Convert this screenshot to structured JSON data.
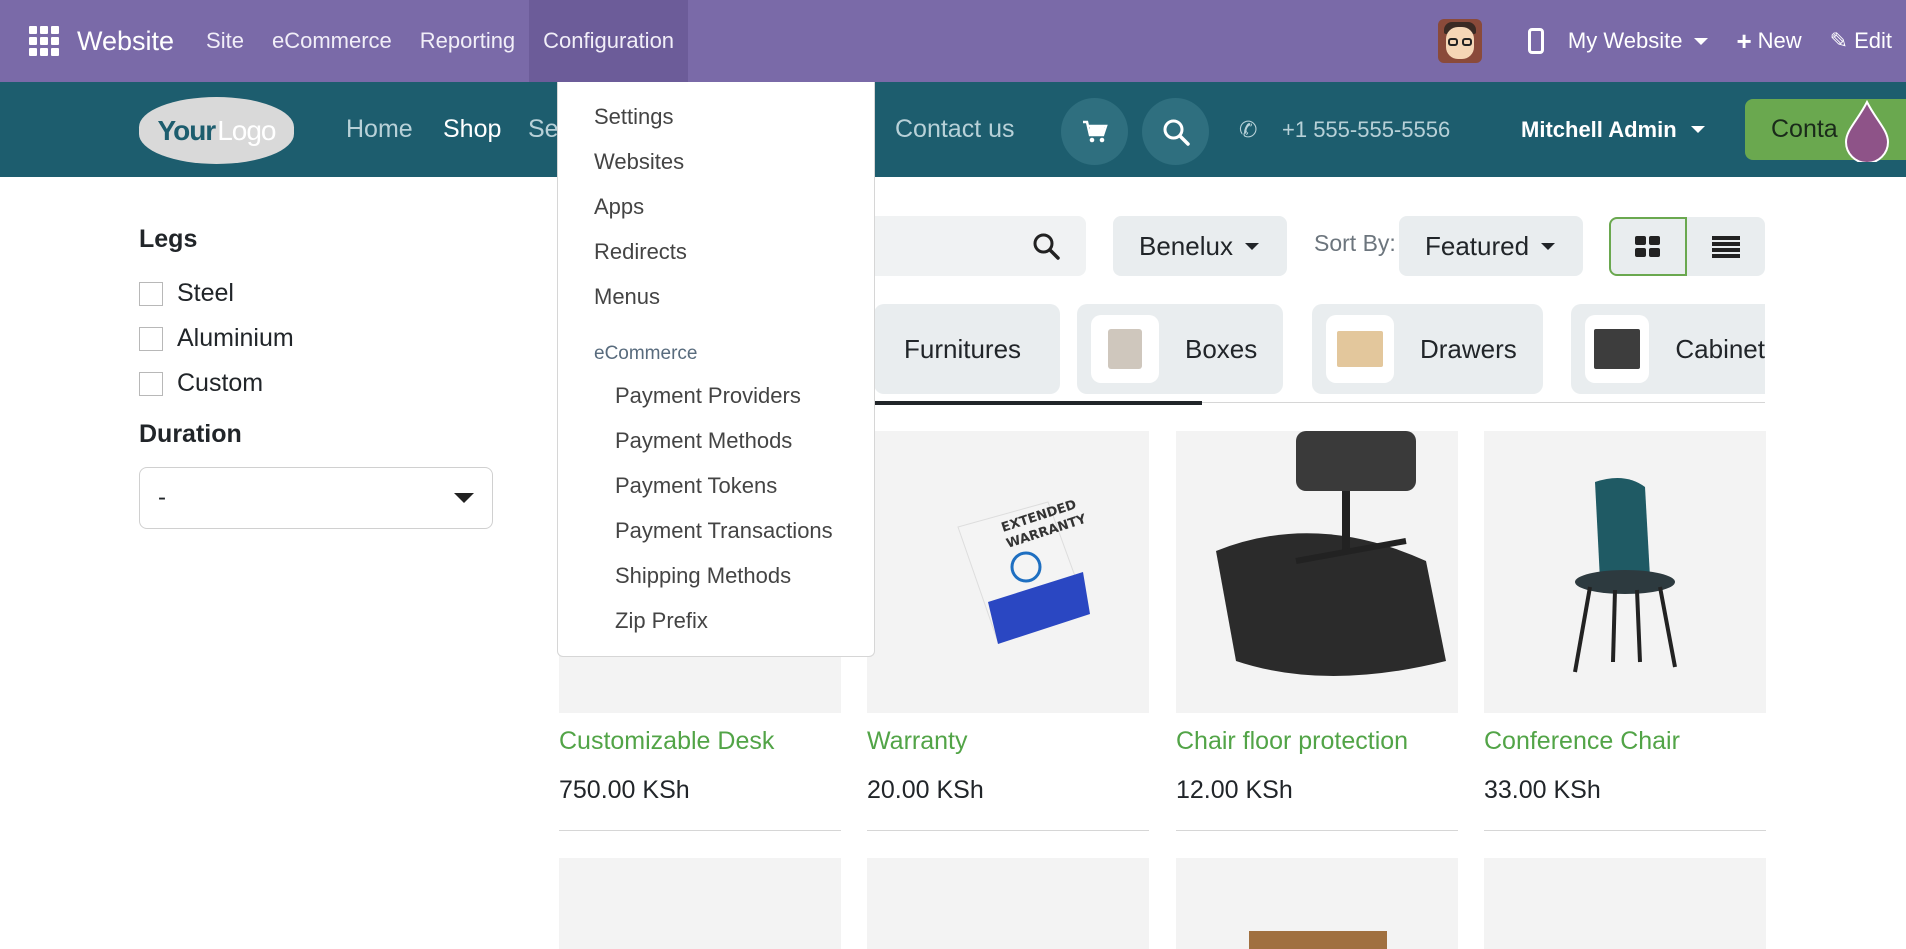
{
  "topbar": {
    "brand": "Website",
    "menus": [
      "Site",
      "eCommerce",
      "Reporting",
      "Configuration"
    ],
    "website_switch": "My Website",
    "new_label": "New",
    "edit_label": "Edit"
  },
  "header": {
    "logo_part1": "Your",
    "logo_part2": "Logo",
    "nav": [
      "Home",
      "Shop",
      "Se"
    ],
    "contact_us": "Contact us",
    "phone": "+1 555-555-5556",
    "user": "Mitchell Admin",
    "contact_btn": "Conta"
  },
  "sidebar": {
    "legs_title": "Legs",
    "legs_options": [
      "Steel",
      "Aluminium",
      "Custom"
    ],
    "duration_title": "Duration",
    "duration_value": "-"
  },
  "toolbar": {
    "pricelist": "Benelux",
    "sort_label": "Sort By:",
    "sort_value": "Featured"
  },
  "categories": [
    "Furnitures",
    "Boxes",
    "Drawers",
    "Cabinet"
  ],
  "products": [
    {
      "name": "Customizable Desk",
      "price": "750.00 KSh"
    },
    {
      "name": "Warranty",
      "price": "20.00 KSh"
    },
    {
      "name": "Chair floor protection",
      "price": "12.00 KSh"
    },
    {
      "name": "Conference Chair",
      "price": "33.00 KSh"
    }
  ],
  "config_menu": {
    "items": [
      "Settings",
      "Websites",
      "Apps",
      "Redirects",
      "Menus"
    ],
    "section": "eCommerce",
    "sub_items": [
      "Payment Providers",
      "Payment Methods",
      "Payment Tokens",
      "Payment Transactions",
      "Shipping Methods",
      "Zip Prefix"
    ]
  },
  "warranty_box": {
    "line1": "EXTENDED",
    "line2": "WARRANTY"
  }
}
